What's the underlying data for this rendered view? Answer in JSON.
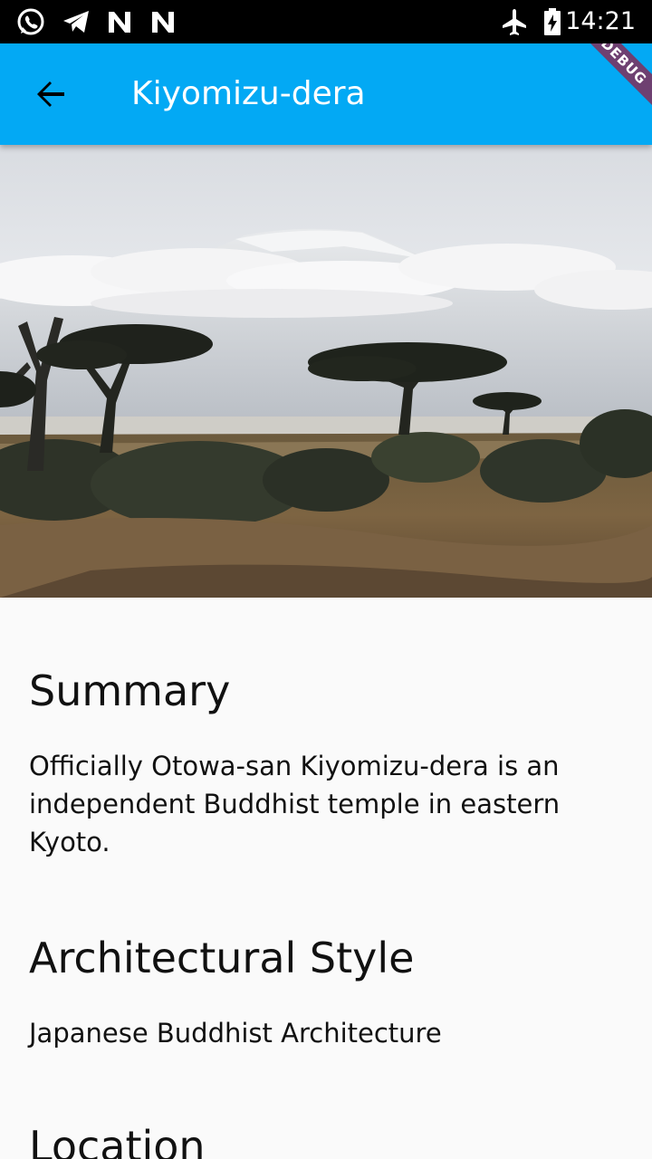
{
  "status_bar": {
    "time": "14:21",
    "left_icons": [
      "whatsapp-icon",
      "telegram-icon",
      "n-app-icon",
      "n-app-icon"
    ],
    "right_icons": [
      "airplane-mode-icon",
      "battery-charging-icon"
    ]
  },
  "app_bar": {
    "title": "Kiyomizu-dera",
    "back_icon": "arrow-back-icon",
    "debug_banner": "DEBUG",
    "color": "#03a9f4"
  },
  "hero": {
    "image": "savanna-landscape"
  },
  "sections": [
    {
      "heading": "Summary",
      "body": "Officially Otowa-san Kiyomizu-dera is an independent Buddhist temple in eastern Kyoto."
    },
    {
      "heading": "Architectural Style",
      "body": "Japanese Buddhist Architecture"
    },
    {
      "heading": "Location",
      "body": ""
    }
  ]
}
